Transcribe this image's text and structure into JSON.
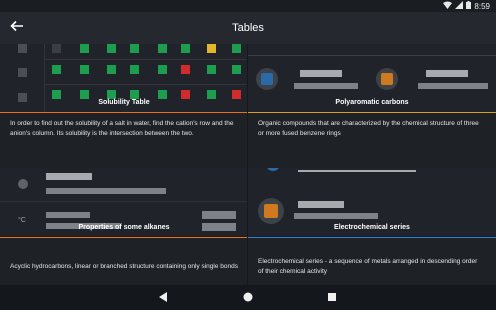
{
  "status_bar": {
    "time": "8:59"
  },
  "app_bar": {
    "title": "Tables",
    "back_icon": "arrow-left-icon"
  },
  "cards": [
    {
      "label": "Solubility Table",
      "description": "In order to find out the solubility of a salt in water, find the cation's row and the anion's column. Its solubility is the intersection between the two.",
      "accent_color": "#e8701f"
    },
    {
      "label": "Polyaromatic carbons",
      "description": "Organic compounds that are characterized by the chemical structure of three or more fused benzene rings",
      "accent_color": "#d4a024"
    },
    {
      "label": "Properties of some alkanes",
      "description": "Acyclic hydrocarbons, linear or branched structure containing only single bonds",
      "accent_color": "#e8701f",
      "unit_symbol": "°C"
    },
    {
      "label": "Electrochemical series",
      "description": "Electrochemical series - a sequence of metals arranged in descending order of their chemical activity",
      "accent_color": "#2f7fd6"
    }
  ],
  "solubility_grid": [
    [
      "dark",
      "green",
      "green",
      "green",
      "green",
      "green",
      "yellow",
      "green"
    ],
    [
      "green",
      "green",
      "green",
      "green",
      "green",
      "red",
      "green",
      "green"
    ],
    [
      "green",
      "green",
      "green",
      "green",
      "green",
      "red",
      "green",
      "red"
    ]
  ],
  "colors": {
    "green": "#1d9d4e",
    "red": "#d12b2b",
    "yellow": "#e2b72d",
    "dark": "#3a3e45",
    "blue_circle": "#2a6aa8",
    "orange_circle": "#d07a1f"
  },
  "nav": {
    "back_icon": "triangle-back-icon",
    "home_icon": "circle-home-icon",
    "recents_icon": "square-recents-icon"
  }
}
